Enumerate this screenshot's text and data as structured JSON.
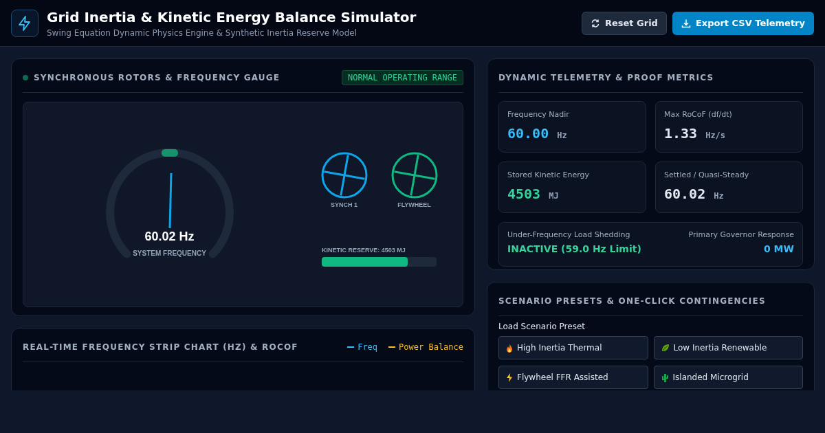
{
  "header": {
    "title": "Grid Inertia & Kinetic Energy Balance Simulator",
    "subtitle": "Swing Equation Dynamic Physics Engine & Synthetic Inertia Reserve Model",
    "buttons": [
      {
        "label": "Reset Grid",
        "kind": "secondary"
      },
      {
        "label": "Export CSV Telemetry",
        "kind": "primary"
      }
    ]
  },
  "rotor_panel": {
    "title": "SYNCHRONOUS ROTORS & FREQUENCY GAUGE",
    "badge": "NORMAL OPERATING RANGE",
    "gauge": {
      "reading": "60.02 Hz",
      "caption": "SYSTEM FREQUENCY"
    },
    "rotors": [
      {
        "label": "SYNCH 1",
        "color": "#0ea5e9"
      },
      {
        "label": "FLYWHEEL",
        "color": "#10b981"
      }
    ],
    "reserve": {
      "label": "KINETIC RESERVE: 4503 MJ",
      "level": 0.75
    }
  },
  "strip_chart": {
    "title": "REAL-TIME FREQUENCY STRIP CHART (HZ) & ROCOF",
    "legend": [
      {
        "label": "Freq",
        "color": "#38bdf8"
      },
      {
        "label": "Power Balance",
        "color": "#fbbf24"
      }
    ]
  },
  "telemetry": {
    "title": "DYNAMIC TELEMETRY & PROOF METRICS",
    "metrics": [
      {
        "label": "Frequency Nadir",
        "value": "60.00",
        "unit": "Hz",
        "color": "#38bdf8"
      },
      {
        "label": "Max RoCoF (df/dt)",
        "value": "1.33",
        "unit": "Hz/s",
        "color": "#e2e8f0"
      },
      {
        "label": "Stored Kinetic Energy",
        "value": "4503",
        "unit": "MJ",
        "color": "#34d399"
      },
      {
        "label": "Settled / Quasi-Steady",
        "value": "60.02",
        "unit": "Hz",
        "color": "#e2e8f0"
      }
    ],
    "shedding": {
      "label": "Under-Frequency Load Shedding",
      "value": "INACTIVE (59.0 Hz Limit)"
    },
    "governor": {
      "label": "Primary Governor Response",
      "value": "0 MW"
    }
  },
  "scenarios": {
    "title": "SCENARIO PRESETS & ONE-CLICK CONTINGENCIES",
    "label": "Load Scenario Preset",
    "presets": [
      {
        "label": "High Inertia Thermal",
        "kind": "flame"
      },
      {
        "label": "Low Inertia Renewable",
        "kind": "leaf"
      },
      {
        "label": "Flywheel FFR Assisted",
        "kind": "bolt"
      },
      {
        "label": "Islanded Microgrid",
        "kind": "cactus"
      }
    ]
  }
}
